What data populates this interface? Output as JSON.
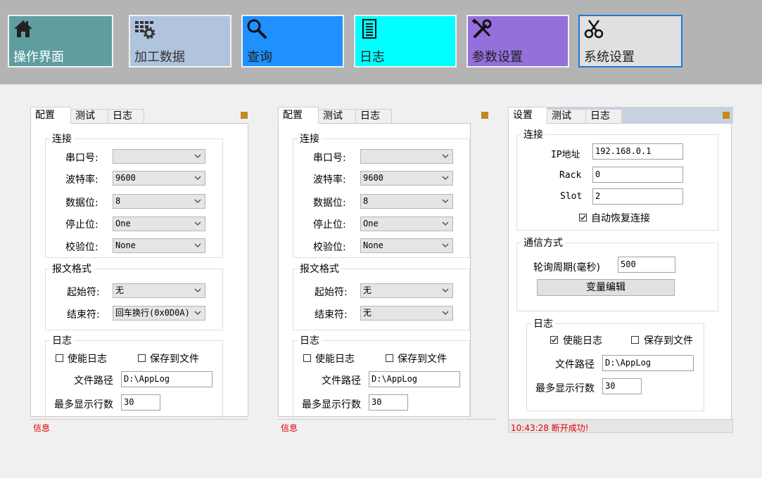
{
  "nav": [
    {
      "label": "操作界面",
      "icon": "home-icon",
      "bg": "#5f9ea0"
    },
    {
      "label": "加工数据",
      "icon": "grid-gear-icon",
      "bg": "#b0c4de"
    },
    {
      "label": "查询",
      "icon": "search-icon",
      "bg": "#1e90ff"
    },
    {
      "label": "日志",
      "icon": "document-icon",
      "bg": "#00ffff"
    },
    {
      "label": "参数设置",
      "icon": "tools-icon",
      "bg": "#9370db"
    },
    {
      "label": "系统设置",
      "icon": "scissors-icon",
      "bg": "#e0e0e0"
    }
  ],
  "serial_panels": [
    {
      "tabs": [
        "配置",
        "测试",
        "日志"
      ],
      "conn_title": "连接",
      "port_label": "串口号:",
      "port_value": "",
      "baud_label": "波特率:",
      "baud_value": "9600",
      "data_label": "数据位:",
      "data_value": "8",
      "stop_label": "停止位:",
      "stop_value": "One",
      "parity_label": "校验位:",
      "parity_value": "None",
      "msg_title": "报文格式",
      "start_label": "起始符:",
      "start_value": "无",
      "end_label": "结束符:",
      "end_value": "回车换行(0x0D0A)",
      "log_title": "日志",
      "enable_log": "使能日志",
      "save_file": "保存到文件",
      "path_label": "文件路径",
      "path_value": "D:\\AppLog",
      "maxlines_label": "最多显示行数",
      "maxlines_value": "30",
      "status": "信息"
    },
    {
      "tabs": [
        "配置",
        "测试",
        "日志"
      ],
      "conn_title": "连接",
      "port_label": "串口号:",
      "port_value": "",
      "baud_label": "波特率:",
      "baud_value": "9600",
      "data_label": "数据位:",
      "data_value": "8",
      "stop_label": "停止位:",
      "stop_value": "One",
      "parity_label": "校验位:",
      "parity_value": "None",
      "msg_title": "报文格式",
      "start_label": "起始符:",
      "start_value": "无",
      "end_label": "结束符:",
      "end_value": "无",
      "log_title": "日志",
      "enable_log": "使能日志",
      "save_file": "保存到文件",
      "path_label": "文件路径",
      "path_value": "D:\\AppLog",
      "maxlines_label": "最多显示行数",
      "maxlines_value": "30",
      "status": "信息"
    }
  ],
  "plc_panel": {
    "tabs": [
      "设置",
      "测试",
      "日志"
    ],
    "conn_title": "连接",
    "ip_label": "IP地址",
    "ip_value": "192.168.0.1",
    "rack_label": "Rack",
    "rack_value": "0",
    "slot_label": "Slot",
    "slot_value": "2",
    "auto_reconnect": "自动恢复连接",
    "auto_reconnect_checked": true,
    "comm_title": "通信方式",
    "poll_label": "轮询周期(毫秒)",
    "poll_value": "500",
    "var_edit": "变量编辑",
    "log_title": "日志",
    "enable_log": "使能日志",
    "enable_log_checked": true,
    "save_file": "保存到文件",
    "path_label": "文件路径",
    "path_value": "D:\\AppLog",
    "maxlines_label": "最多显示行数",
    "maxlines_value": "30",
    "status": "10:43:28 断开成功!"
  }
}
